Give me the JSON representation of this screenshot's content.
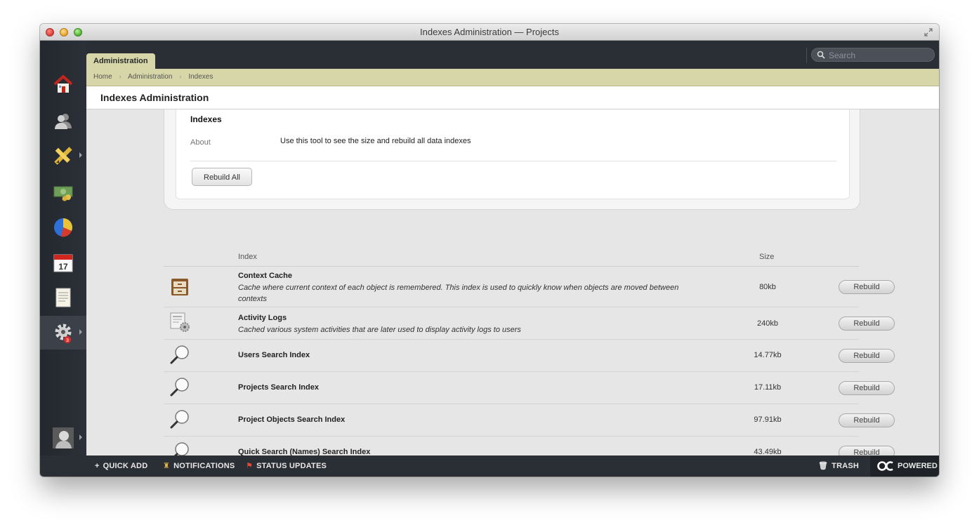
{
  "window": {
    "title": "Indexes Administration — Projects"
  },
  "header": {
    "tab_label": "Administration",
    "search_placeholder": "Search"
  },
  "breadcrumb": [
    "Home",
    "Administration",
    "Indexes"
  ],
  "page": {
    "title": "Indexes Administration"
  },
  "panel": {
    "title": "Indexes",
    "about_label": "About",
    "about_text": "Use this tool to see the size and rebuild all data indexes",
    "rebuild_all_label": "Rebuild All"
  },
  "table": {
    "col_index": "Index",
    "col_size": "Size",
    "rebuild_label": "Rebuild",
    "rows": [
      {
        "name": "Context Cache",
        "desc": "Cache where current context of each object is remembered. This index is used to quickly know when objects are moved between contexts",
        "size": "80kb",
        "icon": "archive-box-icon"
      },
      {
        "name": "Activity Logs",
        "desc": "Cached various system activities that are later used to display activity logs to users",
        "size": "240kb",
        "icon": "news-gear-icon"
      },
      {
        "name": "Users Search Index",
        "desc": "",
        "size": "14.77kb",
        "icon": "magnifier-icon"
      },
      {
        "name": "Projects Search Index",
        "desc": "",
        "size": "17.11kb",
        "icon": "magnifier-icon"
      },
      {
        "name": "Project Objects Search Index",
        "desc": "",
        "size": "97.91kb",
        "icon": "magnifier-icon"
      },
      {
        "name": "Quick Search (Names) Search Index",
        "desc": "",
        "size": "43.49kb",
        "icon": "magnifier-icon"
      }
    ]
  },
  "sidebar": {
    "items": [
      {
        "name": "home-icon"
      },
      {
        "name": "people-icon"
      },
      {
        "name": "pencil-ruler-icon"
      },
      {
        "name": "money-icon"
      },
      {
        "name": "pie-chart-icon"
      },
      {
        "name": "calendar-icon",
        "label": "17"
      },
      {
        "name": "notes-icon"
      },
      {
        "name": "gear-icon",
        "badge": "3"
      },
      {
        "name": "avatar-icon"
      }
    ]
  },
  "footer": {
    "quick_add": "QUICK ADD",
    "notifications": "NOTIFICATIONS",
    "status_updates": "STATUS UPDATES",
    "trash": "TRASH",
    "powered": "POWERED"
  },
  "colors": {
    "dark_bar": "#2a2e35",
    "tab_khaki": "#d7d6a8",
    "content_bg": "#e6e6e6",
    "badge_red": "#e02a2a"
  }
}
